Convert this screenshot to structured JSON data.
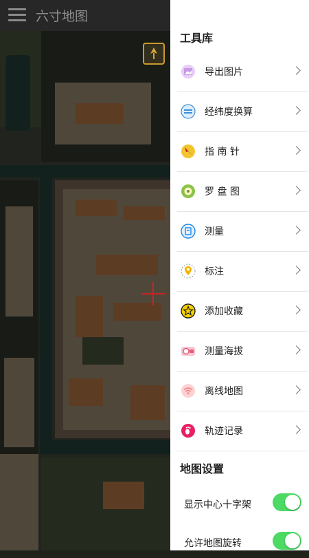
{
  "app": {
    "title": "六寸地图"
  },
  "drawer": {
    "tools_title": "工具库",
    "tools": [
      {
        "label": "导出图片",
        "icon": "image-icon",
        "color": "#d9b3f0"
      },
      {
        "label": "经纬度换算",
        "icon": "coordinate-convert-icon",
        "color": "#3b8fd9"
      },
      {
        "label": "指 南 针",
        "icon": "compass-needle-icon",
        "color": "#f4c430"
      },
      {
        "label": "罗 盘 图",
        "icon": "compass-rose-icon",
        "color": "#8bc34a"
      },
      {
        "label": "测量",
        "icon": "measure-icon",
        "color": "#1e88e5"
      },
      {
        "label": "标注",
        "icon": "map-pin-icon",
        "color": "#f4b400"
      },
      {
        "label": "添加收藏",
        "icon": "star-icon",
        "color": "#f4d000"
      },
      {
        "label": "测量海拔",
        "icon": "altitude-icon",
        "color": "#e55a7a"
      },
      {
        "label": "离线地图",
        "icon": "wifi-icon",
        "color": "#f48a8a"
      },
      {
        "label": "轨迹记录",
        "icon": "footprint-icon",
        "color": "#e91e63"
      }
    ],
    "settings_title": "地图设置",
    "settings": [
      {
        "label": "显示中心十字架",
        "enabled": true
      },
      {
        "label": "允许地图旋转",
        "enabled": true
      }
    ]
  },
  "colors": {
    "toggle_on": "#4cd964",
    "divider": "#e4e4e4"
  }
}
